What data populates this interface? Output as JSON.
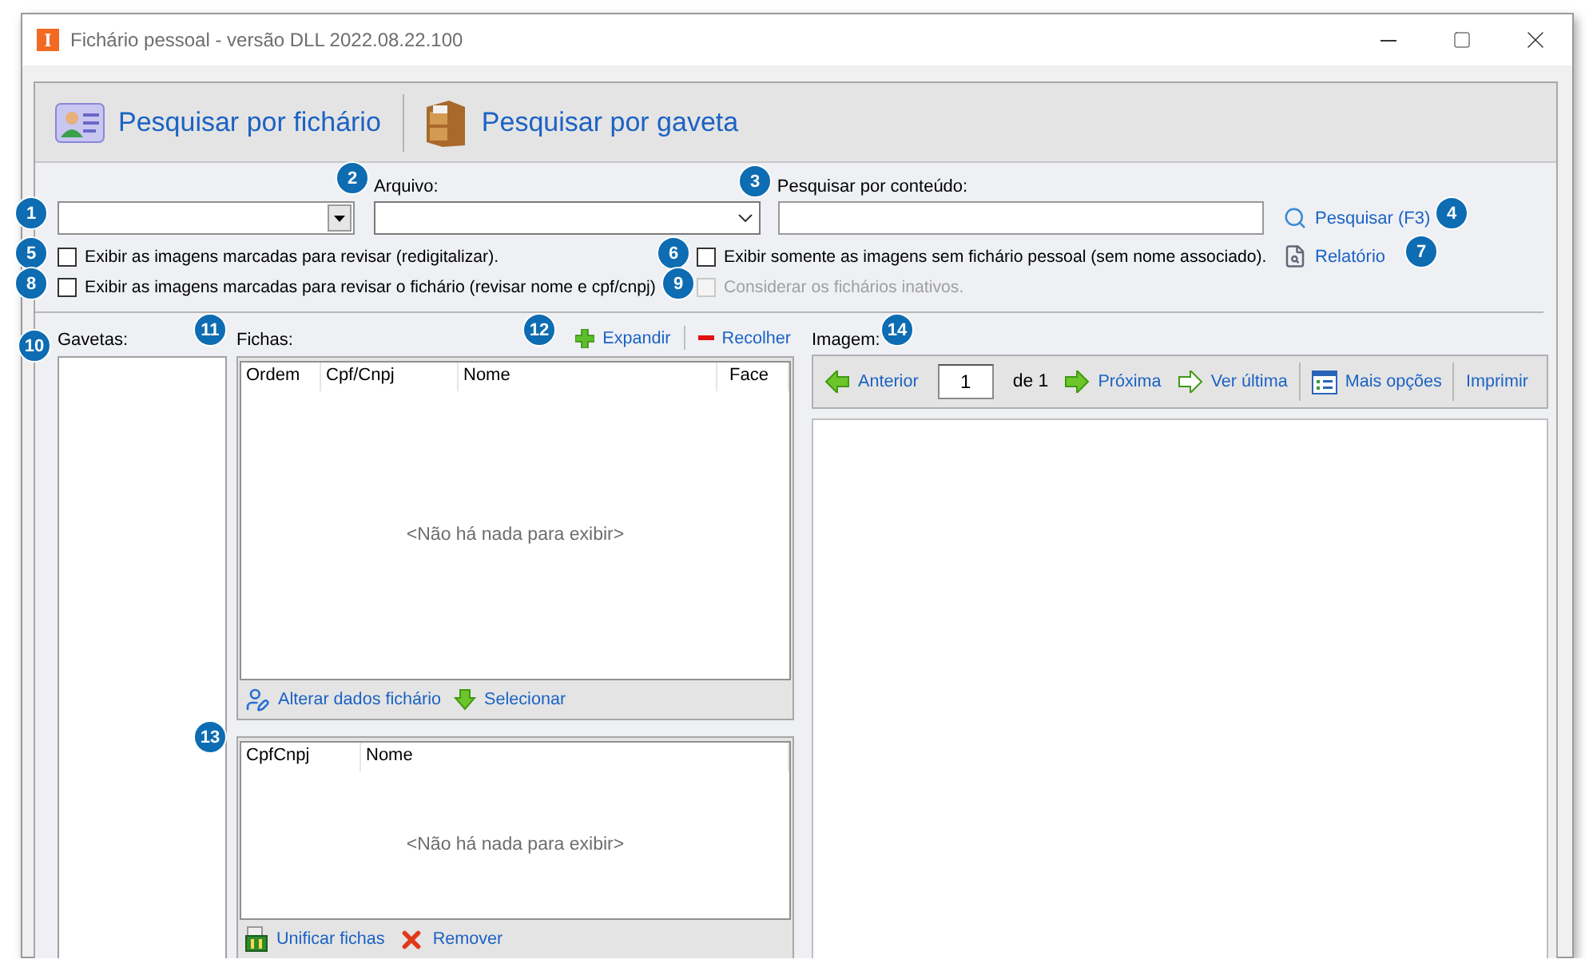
{
  "window": {
    "app_icon": "I",
    "title": "Fichário pessoal - versão DLL 2022.08.22.100"
  },
  "toolbar": [
    {
      "label": "Pesquisar por fichário",
      "kind": "card"
    },
    {
      "label": "Pesquisar por gaveta",
      "kind": "cabinet"
    }
  ],
  "filters": {
    "arquivo_label": "Arquivo:",
    "content_label": "Pesquisar por conteúdo:",
    "search_link": "Pesquisar (F3)",
    "report_link": "Relatório"
  },
  "checkboxes": [
    {
      "label": "Exibir as imagens marcadas para revisar (redigitalizar).",
      "checked": false,
      "disabled": false
    },
    {
      "label": "Exibir somente as imagens sem fichário pessoal (sem nome associado).",
      "checked": false,
      "disabled": false
    },
    {
      "label": "Exibir as imagens marcadas para revisar o fichário (revisar nome e cpf/cnpj)",
      "checked": false,
      "disabled": false
    },
    {
      "label": "Considerar os fichários inativos.",
      "checked": false,
      "disabled": true
    }
  ],
  "callouts": [
    "1",
    "2",
    "3",
    "4",
    "5",
    "6",
    "7",
    "8",
    "9",
    "10",
    "11",
    "12",
    "13",
    "14"
  ],
  "drawers": {
    "label": "Gavetas:"
  },
  "records": {
    "label": "Fichas:",
    "actions": [
      {
        "label": "Expandir",
        "kind": "expand"
      },
      {
        "label": "Recolher",
        "kind": "collapse"
      }
    ],
    "columns": [
      "Ordem",
      "Cpf/Cnpj",
      "Nome",
      "Face"
    ],
    "empty_text": "<Não há nada para exibir>",
    "footer": [
      {
        "label": "Alterar dados fichário",
        "kind": "edit"
      },
      {
        "label": "Selecionar",
        "kind": "down"
      }
    ]
  },
  "merge_list": {
    "columns": [
      "CpfCnpj",
      "Nome"
    ],
    "empty_text": "<Não há nada para exibir>",
    "footer": [
      {
        "label": "Unificar fichas",
        "kind": "merge"
      },
      {
        "label": "Remover",
        "kind": "remove"
      }
    ]
  },
  "image": {
    "label": "Imagem:",
    "nav": [
      {
        "kind": "prev",
        "label": "Anterior"
      },
      {
        "kind": "input",
        "label": "1"
      },
      {
        "kind": "text",
        "label": "de 1"
      },
      {
        "kind": "next",
        "label": "Próxima"
      },
      {
        "kind": "last",
        "label": "Ver última"
      },
      {
        "kind": "separator"
      },
      {
        "kind": "options",
        "label": "Mais opções"
      },
      {
        "kind": "separator"
      },
      {
        "kind": "plain",
        "label": "Imprimir"
      }
    ]
  }
}
